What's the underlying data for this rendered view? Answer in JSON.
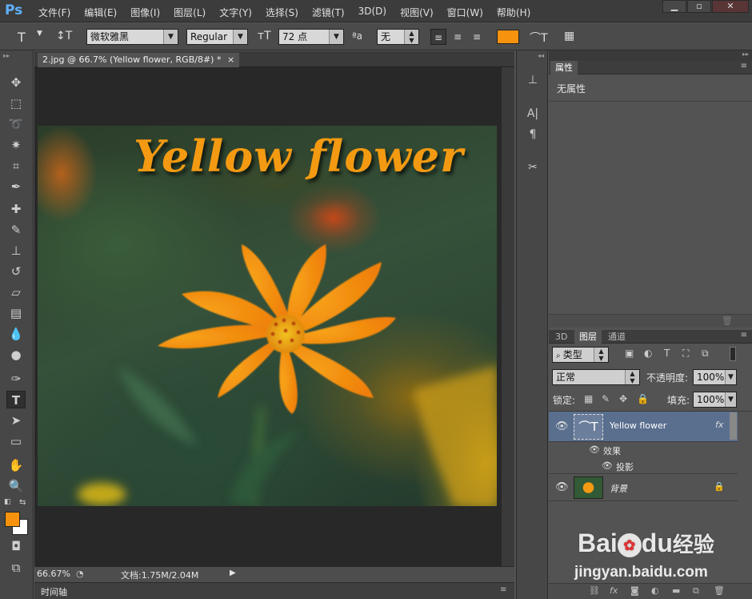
{
  "app": {
    "logo": "Ps"
  },
  "menu": [
    "文件(F)",
    "编辑(E)",
    "图像(I)",
    "图层(L)",
    "文字(Y)",
    "选择(S)",
    "滤镜(T)",
    "3D(D)",
    "视图(V)",
    "窗口(W)",
    "帮助(H)"
  ],
  "window_controls": [
    "▁",
    "▫",
    "✕"
  ],
  "options": {
    "tool_glyph": "T",
    "orient_glyph": "↕T",
    "font_family": "微软雅黑",
    "font_style": "Regular",
    "size_glyph": "тT",
    "font_size": "72 点",
    "aa_glyph": "ªa",
    "antialias": "无",
    "text_color": "#f7920e",
    "warp_glyph": "⌒T",
    "panel_glyph": "▦"
  },
  "document": {
    "tab_title": "2.jpg @ 66.7% (Yellow flower, RGB/8#) *",
    "tab_close": "×",
    "canvas_text": "Yellow flower"
  },
  "status": {
    "zoom": "66.67%",
    "doc_info": "文档:1.75M/2.04M",
    "arrow": "▶"
  },
  "timeline": {
    "label": "时间轴"
  },
  "properties": {
    "tab": "属性",
    "content": "无属性"
  },
  "layers": {
    "tabs": [
      "3D",
      "图层",
      "通道"
    ],
    "filter_kind": "类型",
    "blend_mode": "正常",
    "opacity_label": "不透明度:",
    "opacity": "100%",
    "lock_label": "锁定:",
    "fill_label": "填充:",
    "fill": "100%",
    "rows": [
      {
        "name": "Yellow flower",
        "fx": "fx"
      },
      {
        "name": "效果"
      },
      {
        "name": "投影"
      },
      {
        "name": "背景"
      }
    ]
  },
  "colors": {
    "foreground": "#f7920e",
    "background": "#ffffff",
    "accent": "#5a6f8e"
  },
  "watermark": {
    "brand": "Bai",
    "brand2": "du",
    "brand3": "经验",
    "url": "jingyan.baidu.com"
  }
}
